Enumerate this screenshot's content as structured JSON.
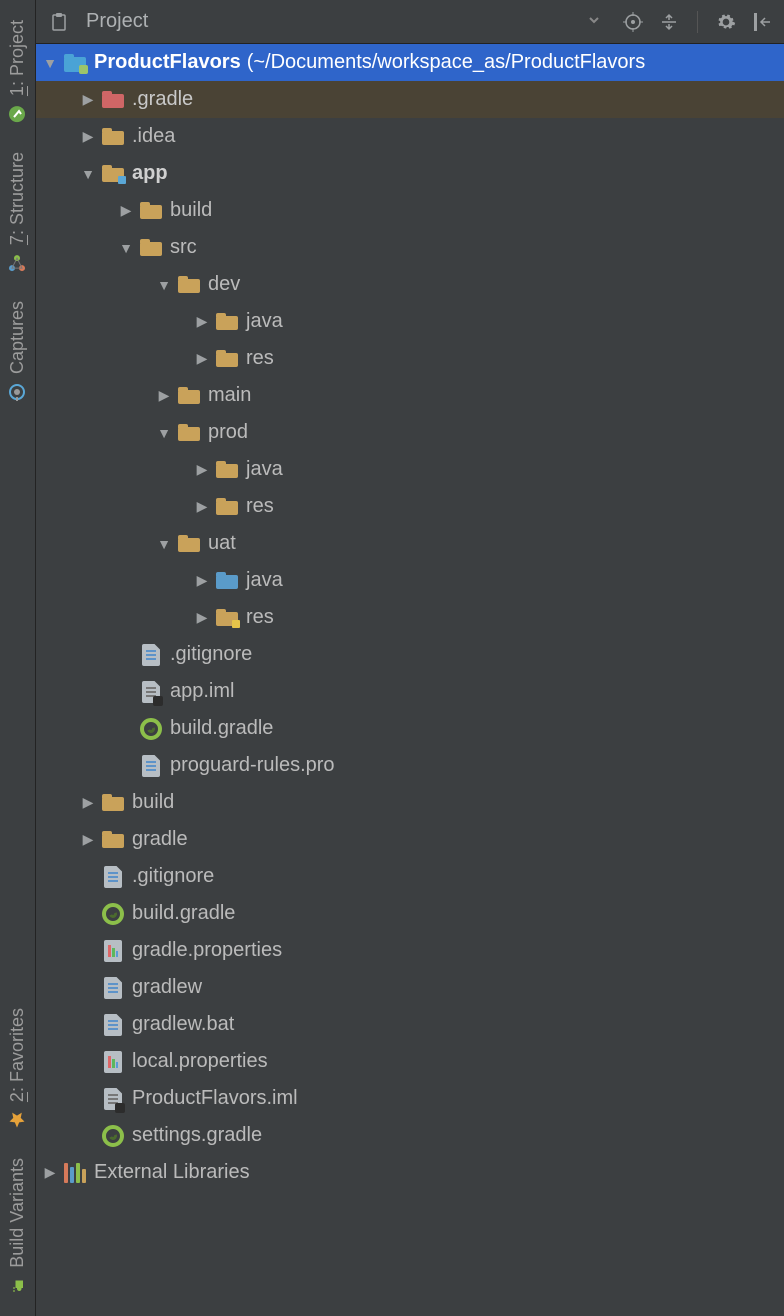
{
  "toolbar": {
    "view_label": "Project"
  },
  "sidebar": {
    "project": {
      "num": "1",
      "label": "Project"
    },
    "structure": {
      "num": "7",
      "label": "Structure"
    },
    "captures": {
      "label": "Captures"
    },
    "favorites": {
      "num": "2",
      "label": "Favorites"
    },
    "build_variants": {
      "label": "Build Variants"
    }
  },
  "tree": {
    "root": {
      "name": "ProductFlavors",
      "path": "(~/Documents/workspace_as/ProductFlavors"
    },
    "gradle_dir": ".gradle",
    "idea_dir": ".idea",
    "app": {
      "name": "app",
      "build": "build",
      "src": {
        "name": "src",
        "dev": {
          "name": "dev",
          "java": "java",
          "res": "res"
        },
        "main": "main",
        "prod": {
          "name": "prod",
          "java": "java",
          "res": "res"
        },
        "uat": {
          "name": "uat",
          "java": "java",
          "res": "res"
        }
      },
      "gitignore": ".gitignore",
      "iml": "app.iml",
      "build_gradle": "build.gradle",
      "proguard": "proguard-rules.pro"
    },
    "build_dir": "build",
    "gradle_folder": "gradle",
    "root_files": {
      "gitignore": ".gitignore",
      "build_gradle": "build.gradle",
      "gradle_properties": "gradle.properties",
      "gradlew": "gradlew",
      "gradlew_bat": "gradlew.bat",
      "local_properties": "local.properties",
      "iml": "ProductFlavors.iml",
      "settings_gradle": "settings.gradle"
    },
    "external_libraries": "External Libraries"
  }
}
